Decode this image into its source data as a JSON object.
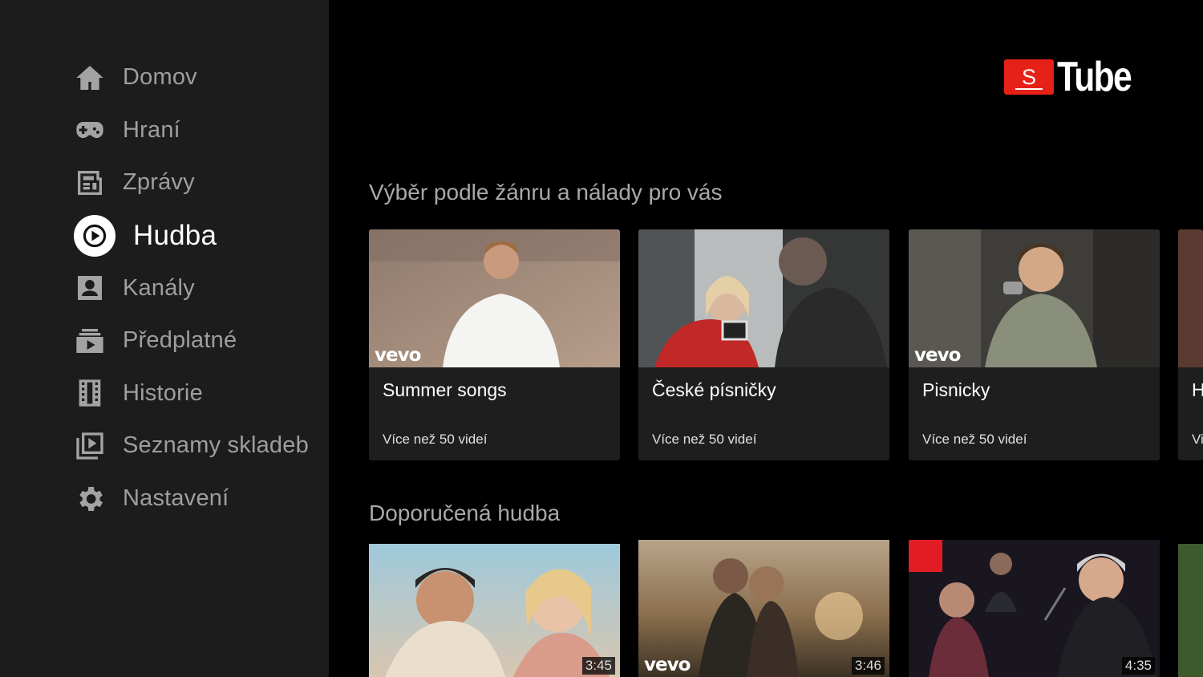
{
  "app": {
    "logo_box_letter": "S",
    "logo_text": "Tube",
    "accent_color": "#e62117"
  },
  "sidebar": {
    "items": [
      {
        "label": "Domov",
        "icon": "home-icon",
        "active": false
      },
      {
        "label": "Hraní",
        "icon": "gamepad-icon",
        "active": false
      },
      {
        "label": "Zprávy",
        "icon": "news-icon",
        "active": false
      },
      {
        "label": "Hudba",
        "icon": "music-play-icon",
        "active": true
      },
      {
        "label": "Kanály",
        "icon": "account-box-icon",
        "active": false
      },
      {
        "label": "Předplatné",
        "icon": "subscriptions-icon",
        "active": false
      },
      {
        "label": "Historie",
        "icon": "film-history-icon",
        "active": false
      },
      {
        "label": "Seznamy skladeb",
        "icon": "playlist-icon",
        "active": false
      },
      {
        "label": "Nastavení",
        "icon": "settings-gear-icon",
        "active": false
      }
    ]
  },
  "shelves": [
    {
      "title": "Výběr podle žánru a nálady pro vás",
      "cards": [
        {
          "title": "Summer songs",
          "subtitle": "Více než 50 videí",
          "vevo": "vevo"
        },
        {
          "title": "České písničky",
          "subtitle": "Více než 50 videí",
          "vevo": ""
        },
        {
          "title": "Pisnicky",
          "subtitle": "Více než 50 videí",
          "vevo": "vevo"
        },
        {
          "title": "H",
          "subtitle": "Vi",
          "vevo": ""
        }
      ]
    },
    {
      "title": "Doporučená hudba",
      "videos": [
        {
          "duration": "3:45",
          "vevo": ""
        },
        {
          "duration": "3:46",
          "vevo": "vevo"
        },
        {
          "duration": "4:35",
          "vevo": ""
        }
      ]
    }
  ]
}
